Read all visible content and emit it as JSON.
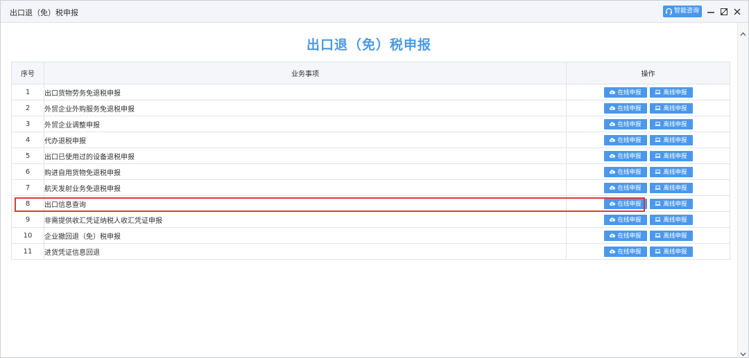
{
  "window": {
    "title": "出口退（免）税申报",
    "assist_label": "智能咨询"
  },
  "page": {
    "title": "出口退（免）税申报"
  },
  "table": {
    "headers": {
      "no": "序号",
      "item": "业务事项",
      "ops": "操作"
    },
    "buttons": {
      "online": "在线申报",
      "offline": "离线申报"
    },
    "rows": [
      {
        "no": "1",
        "item": "出口货物劳务免退税申报"
      },
      {
        "no": "2",
        "item": "外贸企业外购服务免退税申报"
      },
      {
        "no": "3",
        "item": "外贸企业调整申报"
      },
      {
        "no": "4",
        "item": "代办退税申报"
      },
      {
        "no": "5",
        "item": "出口已使用过的设备退税申报"
      },
      {
        "no": "6",
        "item": "购进自用货物免退税申报"
      },
      {
        "no": "7",
        "item": "航天发射业务免退税申报"
      },
      {
        "no": "8",
        "item": "出口信息查询"
      },
      {
        "no": "9",
        "item": "非需提供收汇凭证纳税人收汇凭证申报"
      },
      {
        "no": "10",
        "item": "企业撤回退（免）税申报"
      },
      {
        "no": "11",
        "item": "进货凭证信息回退"
      }
    ],
    "highlighted_row": 8
  },
  "colors": {
    "accent": "#4a98ec",
    "title": "#4a9ae6",
    "highlight": "#d93a3a"
  },
  "icons": {
    "assist": "headset-icon",
    "minimize": "minimize-icon",
    "maximize": "maximize-icon",
    "close": "close-icon",
    "online": "cloud-upload-icon",
    "offline": "laptop-icon"
  }
}
